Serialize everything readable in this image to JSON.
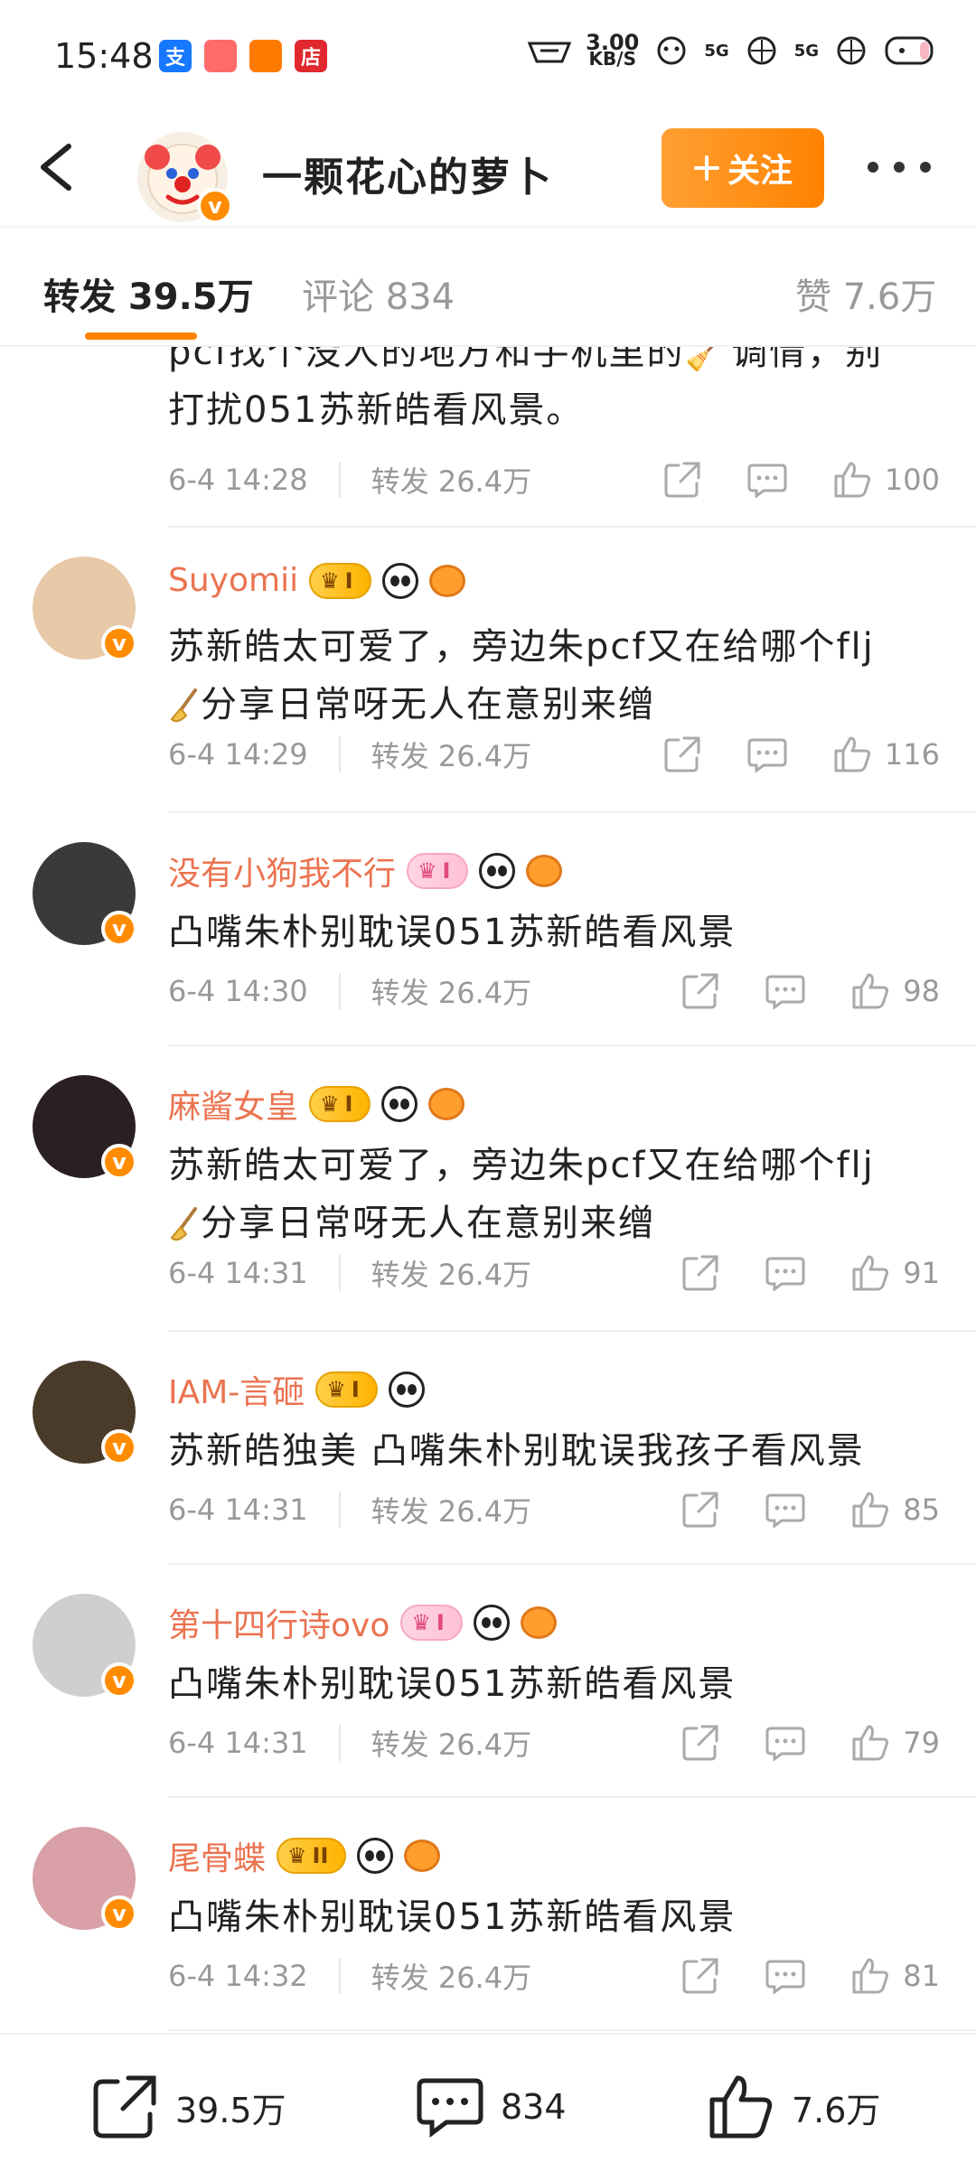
{
  "status_bar": {
    "time": "15:48",
    "apps": [
      {
        "label": "支",
        "color": "#1677ff",
        "name": "alipay-icon"
      },
      {
        "label": "",
        "color": "#ff6a6a",
        "name": "pinwheel-icon"
      },
      {
        "label": "",
        "color": "#ff7a00",
        "name": "tv-icon"
      },
      {
        "label": "店",
        "color": "#e0282e",
        "name": "shop-icon"
      }
    ],
    "speed_value": "3.00",
    "speed_unit": "KB/S",
    "net1": "5G",
    "net2": "5G"
  },
  "header": {
    "title": "一颗花心的萝卜",
    "follow_label": "关注"
  },
  "tabs": {
    "repost": "转发 39.5万",
    "comment": "评论 834",
    "like": "赞 7.6万"
  },
  "feed": {
    "partial": {
      "line1": "pcf找个没人的地方和手机里的🧹调情，别",
      "line2": "打扰051苏新皓看风景。",
      "time": "6-4 14:28",
      "repost": "转发 26.4万",
      "likes": "100"
    },
    "items": [
      {
        "name": "Suyomii",
        "vip": "I",
        "vip_style": "gold",
        "has_fish": true,
        "line1": "苏新皓太可爱了，旁边朱pcf又在给哪个flj",
        "line2": "分享日常呀无人在意别来缯",
        "has_broom": true,
        "time": "6-4 14:29",
        "repost": "转发 26.4万",
        "likes": "116",
        "avatar_color": "#e8c9a8"
      },
      {
        "name": "没有小狗我不行",
        "vip": "I",
        "vip_style": "pink",
        "has_fish": true,
        "line1": "凸嘴朱朴别耽误051苏新皓看风景",
        "line2": "",
        "has_broom": false,
        "time": "6-4 14:30",
        "repost": "转发 26.4万",
        "likes": "98",
        "avatar_color": "#3a3a3a"
      },
      {
        "name": "麻酱女皇",
        "vip": "I",
        "vip_style": "gold",
        "has_fish": true,
        "line1": "苏新皓太可爱了，旁边朱pcf又在给哪个flj",
        "line2": "分享日常呀无人在意别来缯",
        "has_broom": true,
        "time": "6-4 14:31",
        "repost": "转发 26.4万",
        "likes": "91",
        "avatar_color": "#2a1f22"
      },
      {
        "name": "IAM-言砸",
        "vip": "I",
        "vip_style": "gold",
        "has_fish": false,
        "line1": "苏新皓独美 凸嘴朱朴别耽误我孩子看风景",
        "line2": "",
        "has_broom": false,
        "time": "6-4 14:31",
        "repost": "转发 26.4万",
        "likes": "85",
        "avatar_color": "#4a3a2a"
      },
      {
        "name": "第十四行诗ovo",
        "vip": "I",
        "vip_style": "pink",
        "has_fish": true,
        "line1": "凸嘴朱朴别耽误051苏新皓看风景",
        "line2": "",
        "has_broom": false,
        "time": "6-4 14:31",
        "repost": "转发 26.4万",
        "likes": "79",
        "avatar_color": "#cfcfcf"
      },
      {
        "name": "尾骨蝶",
        "vip": "II",
        "vip_style": "gold",
        "has_fish": true,
        "line1": "凸嘴朱朴别耽误051苏新皓看风景",
        "line2": "",
        "has_broom": false,
        "time": "6-4 14:32",
        "repost": "转发 26.4万",
        "likes": "81",
        "avatar_color": "#d9a0a8"
      }
    ]
  },
  "bottom_bar": {
    "repost": "39.5万",
    "comment": "834",
    "like": "7.6万"
  },
  "colors": {
    "accent": "#ff8200",
    "username": "#eb7350",
    "muted": "#999999"
  }
}
